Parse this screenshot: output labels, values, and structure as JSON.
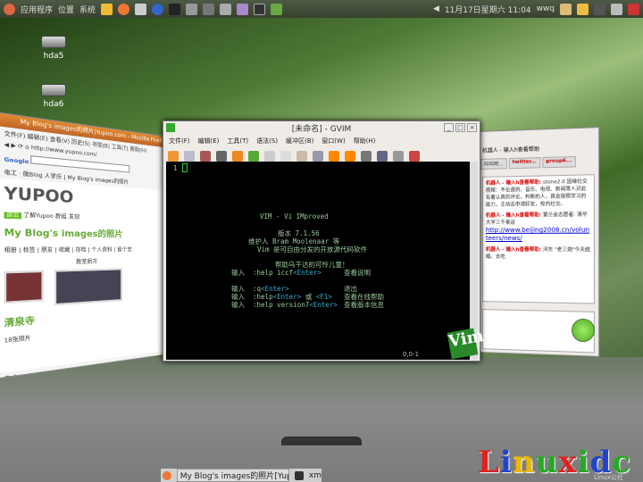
{
  "top_panel": {
    "menus": [
      "应用程序",
      "位置",
      "系统"
    ],
    "datetime": "11月17日星期六 11:04",
    "user": "wwq"
  },
  "desktop_icons": [
    {
      "label": "hda5"
    },
    {
      "label": "hda6"
    }
  ],
  "gvim": {
    "title": "[未命名] - GVIM",
    "menu": [
      "文件(F)",
      "编辑(E)",
      "工具(T)",
      "语法(S)",
      "缓冲区(B)",
      "窗口(W)",
      "帮助(H)"
    ],
    "line_number": "1",
    "splash": {
      "title": "VIM - Vi IMproved",
      "version": "版本 7.1.56",
      "maintainer": "维护人 Bram Moolenaar 等",
      "license": "Vim 是可自由分发的开放源代码软件",
      "charity": "帮助乌干达的可怜儿童！",
      "rows": [
        {
          "prefix": "输入",
          "cmd": ":help iccf",
          "key": "<Enter>",
          "mid": "",
          "key2": "",
          "desc": "查看说明"
        },
        {
          "prefix": "输入",
          "cmd": ":q",
          "key": "<Enter>",
          "mid": "",
          "key2": "",
          "desc": "退出"
        },
        {
          "prefix": "输入",
          "cmd": ":help",
          "key": "<Enter>",
          "mid": " 或 ",
          "key2": "<F1>",
          "desc": "查看在线帮助"
        },
        {
          "prefix": "输入",
          "cmd": ":help version7",
          "key": "<Enter>",
          "mid": "",
          "key2": "",
          "desc": "查看版本信息"
        }
      ]
    },
    "ruler": "0,0-1",
    "logo": "Vim"
  },
  "firefox": {
    "title": "My Blog's images的照片|Yupoo.com - Mozilla Firefox",
    "menu": "文件(F) 编辑(E) 查看(V) 历史(S) 书签(B) 工具(T) 帮助(H)",
    "url": "http://www.yupoo.com/",
    "search_engine": "Google",
    "tabs": "电工 · 微Blog 人学乐 | My Blog's images的照片",
    "logo": "YUPOO",
    "nav": [
      "首页",
      "了解Yupoo",
      "群组",
      "发现"
    ],
    "page_title": "My Blog's images的照片",
    "links": "相册 | 标签 | 朋友 | 收藏 | 存档 | 个人资料 | 留个言",
    "section": "教室后方",
    "album": "清泉寺",
    "album_count": "18张照片",
    "status": "完成"
  },
  "pidgin": {
    "title": "机器人 - 输入h查看帮助",
    "tabs": [
      "叫叫吧...",
      "twitter...",
      "group6..."
    ],
    "messages": [
      {
        "sender": "机器人 - 输入h查看帮助:",
        "text": "stone2.0 因缘社交圈报：不论遇到、音乐、电视、新闻等人对此有着认真的评论，判断的人，真会按照学习的能力，主动去申请好友，校内社交。"
      },
      {
        "sender": "机器人 - 输入h查看帮助:",
        "text": "第兰会志愿者: 清华大学三千奥运",
        "link": "http://www.beijing2008.cn/volunteers/news/"
      },
      {
        "sender": "机器人 - 输入h查看帮助:",
        "text": "河东 \"老三炮\"今天结婚。去吃"
      }
    ]
  },
  "taskbar": {
    "items": [
      "My Blog's images的照片[Yup...",
      "xm"
    ]
  },
  "watermark": {
    "text": "Linuxidc",
    "sub": "Linux公社",
    "colors": [
      "#d22",
      "#24c",
      "#e8b800",
      "#2a2",
      "#d22",
      "#2a2",
      "#24c",
      "#2a2"
    ]
  }
}
